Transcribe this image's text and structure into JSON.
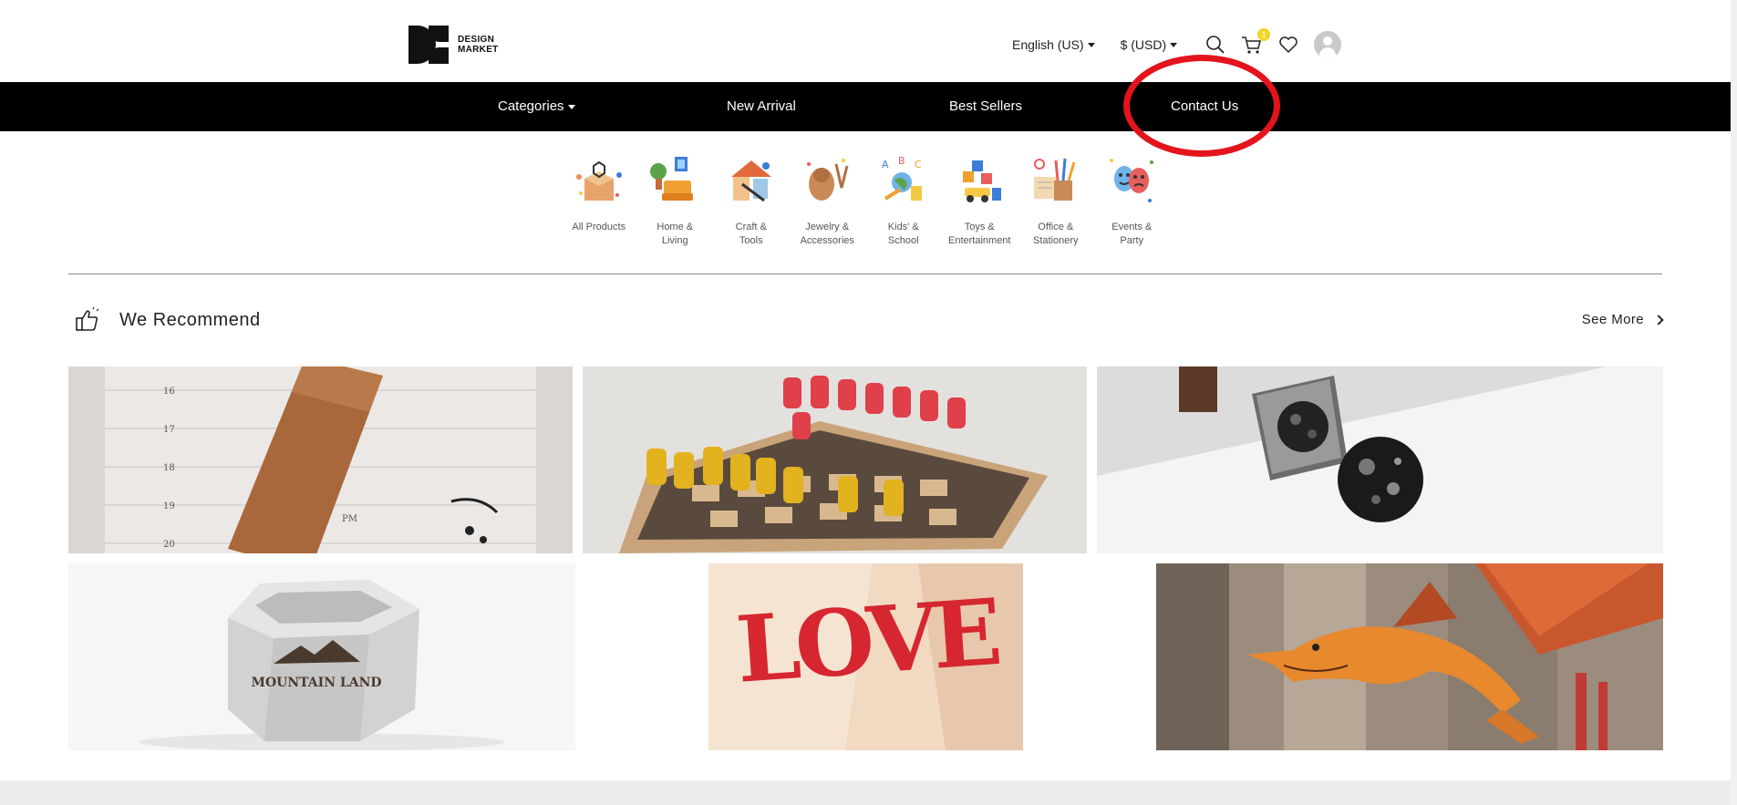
{
  "brand": {
    "line1": "DESIGN",
    "line2": "MARKET"
  },
  "header": {
    "language": "English (US)",
    "currency": "$ (USD)",
    "cart_count": "1"
  },
  "nav": {
    "items": [
      {
        "label": "Categories"
      },
      {
        "label": "New Arrival"
      },
      {
        "label": "Best Sellers"
      },
      {
        "label": "Contact Us"
      }
    ]
  },
  "categories": [
    {
      "label": "All Products"
    },
    {
      "label": "Home &\nLiving"
    },
    {
      "label": "Craft &\nTools"
    },
    {
      "label": "Jewelry &\nAccessories"
    },
    {
      "label": "Kids' &\nSchool"
    },
    {
      "label": "Toys &\nEntertainment"
    },
    {
      "label": "Office &\nStationery"
    },
    {
      "label": "Events &\nParty"
    }
  ],
  "recommend": {
    "title": "We Recommend",
    "see_more": "See More",
    "products": [
      {
        "name": "wine-cork-calendar"
      },
      {
        "name": "laser-cut-chess-set"
      },
      {
        "name": "moon-rubber-stamp"
      },
      {
        "name": "concrete-planter",
        "text": "MOUNTAIN LAND"
      },
      {
        "name": "love-popup-card",
        "text": "LOVE"
      },
      {
        "name": "wooden-dinosaur-model"
      }
    ]
  },
  "colors": {
    "nav_bg": "#000000",
    "highlight": "#e3141c",
    "badge": "#f5d42a"
  },
  "icons": [
    "search-icon",
    "cart-icon",
    "heart-icon",
    "user-avatar-icon",
    "thumbs-up-icon",
    "chevron-right-icon"
  ]
}
